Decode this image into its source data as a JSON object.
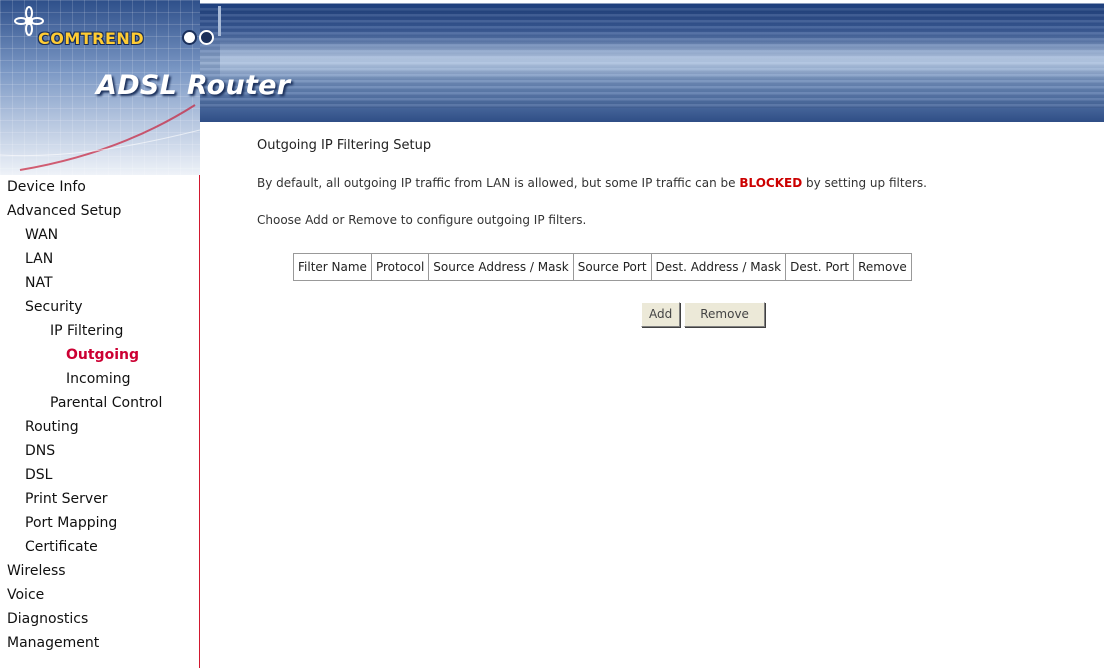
{
  "header": {
    "brand": "COMTREND",
    "product": "ADSL Router",
    "colors": {
      "header_blue": "#2e4f8a",
      "brand_yellow": "#ffcc33",
      "accent_red": "#cc0033"
    }
  },
  "sidebar": {
    "items": [
      {
        "label": "Device Info",
        "level": 0
      },
      {
        "label": "Advanced Setup",
        "level": 0
      },
      {
        "label": "WAN",
        "level": 1
      },
      {
        "label": "LAN",
        "level": 1
      },
      {
        "label": "NAT",
        "level": 1
      },
      {
        "label": "Security",
        "level": 1
      },
      {
        "label": "IP Filtering",
        "level": 2
      },
      {
        "label": "Outgoing",
        "level": 3,
        "active": true
      },
      {
        "label": "Incoming",
        "level": 3
      },
      {
        "label": "Parental Control",
        "level": 2
      },
      {
        "label": "Routing",
        "level": 1
      },
      {
        "label": "DNS",
        "level": 1
      },
      {
        "label": "DSL",
        "level": 1
      },
      {
        "label": "Print Server",
        "level": 1
      },
      {
        "label": "Port Mapping",
        "level": 1
      },
      {
        "label": "Certificate",
        "level": 1
      },
      {
        "label": "Wireless",
        "level": 0
      },
      {
        "label": "Voice",
        "level": 0
      },
      {
        "label": "Diagnostics",
        "level": 0
      },
      {
        "label": "Management",
        "level": 0
      }
    ]
  },
  "main": {
    "title": "Outgoing IP Filtering Setup",
    "intro_before": "By default, all outgoing IP traffic from LAN is allowed, but some IP traffic can be ",
    "intro_emphasis": "BLOCKED",
    "intro_after": " by setting up filters.",
    "hint": "Choose Add or Remove to configure outgoing IP filters.",
    "table": {
      "columns": [
        "Filter Name",
        "Protocol",
        "Source Address / Mask",
        "Source Port",
        "Dest. Address / Mask",
        "Dest. Port",
        "Remove"
      ]
    },
    "buttons": {
      "add": "Add",
      "remove": "Remove"
    }
  }
}
